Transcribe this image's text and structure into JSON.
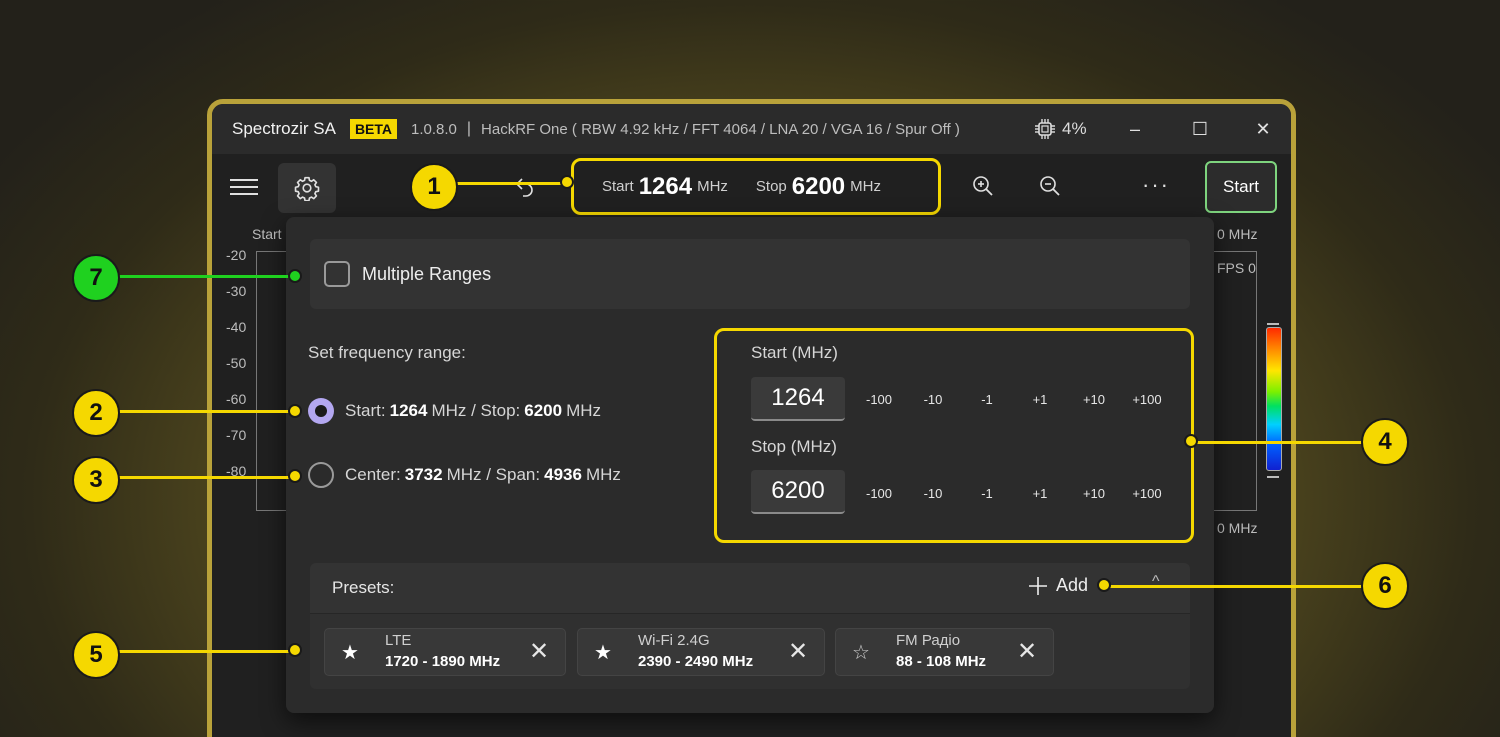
{
  "titlebar": {
    "app_name": "Spectrozir SA",
    "badge": "BETA",
    "version": "1.0.8.0",
    "separator": "|",
    "device": "HackRF One  ( RBW 4.92 kHz / FFT 4064 / LNA 20 / VGA 16 / Spur Off )",
    "cpu": "4%",
    "minimize": "–",
    "maximize": "☐",
    "close": "✕"
  },
  "toolbar": {
    "start_label": "Start",
    "start_value": "1264",
    "start_unit": "MHz",
    "stop_label": "Stop",
    "stop_value": "6200",
    "stop_unit": "MHz",
    "more": "···",
    "start_button": "Start"
  },
  "background": {
    "start_partial": "Start",
    "stop_partial": "0 MHz",
    "fps": "FPS 0",
    "bottom_partial": "0 MHz",
    "y_ticks": [
      "-20",
      "-30",
      "-40",
      "-50",
      "-60",
      "-70",
      "-80"
    ]
  },
  "panel": {
    "multiple_ranges": "Multiple Ranges",
    "set_frequency_range": "Set frequency range:",
    "option1": {
      "start_label": "Start:",
      "start": "1264",
      "mhz1": "MHz / Stop:",
      "stop": "6200",
      "mhz2": "MHz"
    },
    "option2": {
      "center_label": "Center:",
      "center": "3732",
      "mhz1": "MHz / Span:",
      "span": "4936",
      "mhz2": "MHz"
    },
    "start_field_label": "Start (MHz)",
    "start_field_value": "1264",
    "stop_field_label": "Stop (MHz)",
    "stop_field_value": "6200",
    "steps": [
      "-100",
      "-10",
      "-1",
      "+1",
      "+10",
      "+100"
    ],
    "presets_label": "Presets:",
    "add_label": "Add",
    "presets": [
      {
        "name": "LTE",
        "range": "1720 - 1890 MHz",
        "starred": true
      },
      {
        "name": "Wi-Fi 2.4G",
        "range": "2390 - 2490 MHz",
        "starred": true
      },
      {
        "name": "FM Радіо",
        "range": "88 - 108 MHz",
        "starred": false
      }
    ]
  },
  "callouts": [
    "1",
    "2",
    "3",
    "4",
    "5",
    "6",
    "7"
  ],
  "colors": {
    "highlight": "#f5d800",
    "callout_green": "#1fd11f",
    "start_border": "#7ed47e",
    "radio_selected": "#b3a7f0"
  }
}
